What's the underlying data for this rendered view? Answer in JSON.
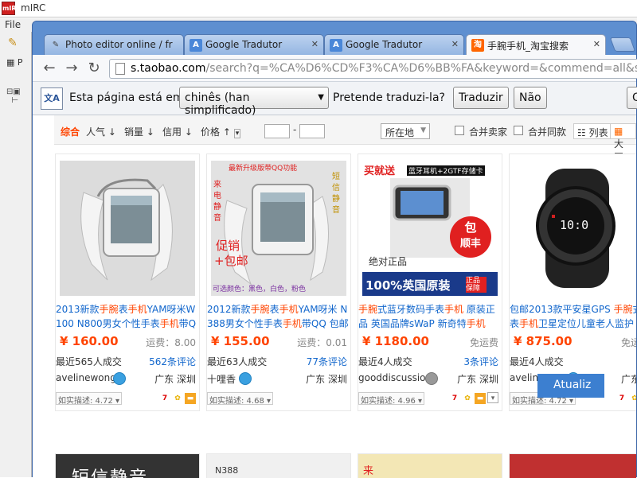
{
  "mirc": {
    "title": "mIRC",
    "menu_file": "File",
    "tb2_label": "P"
  },
  "tabs": [
    {
      "label": "Photo editor online / fr",
      "icon": "photo-editor-icon"
    },
    {
      "label": "Google Tradutor",
      "icon": "google-translate-icon"
    },
    {
      "label": "Google Tradutor",
      "icon": "google-translate-icon"
    },
    {
      "label": "手腕手机_淘宝搜索",
      "icon": "taobao-icon"
    }
  ],
  "address": {
    "host": "s.taobao.com",
    "path": "/search?q=%CA%D6%CD%F3%CA%D6%BB%FA&keyword=&commend=all&ssid=s"
  },
  "translate": {
    "prefix": "Esta página está em",
    "language": "chinês (han simplificado)",
    "question": "Pretende traduzi-la?",
    "translate_button": "Traduzir",
    "no_button": "Não",
    "options_button": "O"
  },
  "sortbar": {
    "items": [
      "综合",
      "人气",
      "销量",
      "信用",
      "价格"
    ],
    "location": "所在地",
    "merge_seller": "合并卖家",
    "merge_same": "合并同款",
    "list_view": "列表",
    "grid_view": "大图"
  },
  "products": [
    {
      "title_parts": [
        "2013新款",
        "手腕",
        "表",
        "手机",
        "YAM呀米W100 N800男女个性手表",
        "手机",
        "带QQ"
      ],
      "price": "¥ 160.00",
      "shipping": "运费：8.00",
      "sold": "最近565人成交",
      "reviews": "562条评论",
      "seller": "avelinewong",
      "location": "广东 深圳",
      "rating": "如实描述: 4.72"
    },
    {
      "title_parts": [
        "2012新款",
        "手腕",
        "表",
        "手机",
        "YAM呀米 N388男女个性手表",
        "手机",
        "带QQ 包邮"
      ],
      "price": "¥ 155.00",
      "shipping": "运费：0.01",
      "sold": "最近63人成交",
      "reviews": "77条评论",
      "seller": "十哩香",
      "location": "广东 深圳",
      "rating": "如实描述: 4.68",
      "image_text": {
        "top": "最新升级版带QQ功能",
        "left": "来电静音",
        "right": "短信静音",
        "promo1": "促销",
        "promo2": "+包邮",
        "colors": "可选颜色：黑色，白色，粉色"
      }
    },
    {
      "title_parts": [
        "",
        "手腕",
        "式蓝牙数码手表",
        "手机",
        " 原装正品 英国品牌sWaP 新奇特",
        "手机",
        ""
      ],
      "price": "¥ 1180.00",
      "shipping": "免运费",
      "sold": "最近4人成交",
      "reviews": "3条评论",
      "seller": "gooddiscussion",
      "location": "广东 深圳",
      "rating": "如实描述: 4.96",
      "image_text": {
        "top1": "买就送",
        "top2": "蓝牙耳机+2GTF存储卡",
        "badge1": "包",
        "badge2": "顺丰",
        "auth": "绝对正品",
        "bottom": "100%英国原装",
        "bottom2": "正品保障"
      }
    },
    {
      "title_parts": [
        "包邮2013款平安星GPS ",
        "手腕",
        "式",
        "手",
        "表",
        "手机",
        "卫星定位儿童老人监护",
        ""
      ],
      "price": "¥ 875.00",
      "shipping": "免运",
      "sold": "最近4人成交",
      "reviews": "",
      "seller": "avelinewong",
      "location": "广东",
      "rating": "如实描述: 4.72",
      "image_text": {
        "time": "10:0"
      }
    }
  ],
  "row2": [
    {
      "text": "短信静音"
    },
    {
      "text": "N388"
    },
    {
      "text": "来"
    },
    {
      "text": ""
    }
  ],
  "atualiza": "Atualiz"
}
